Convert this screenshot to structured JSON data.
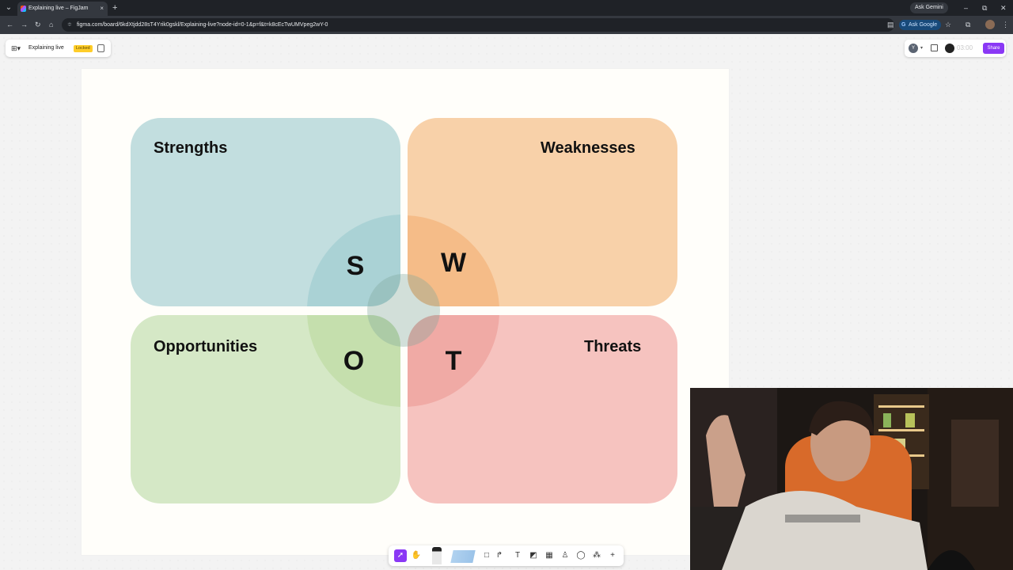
{
  "browser": {
    "tab_title": "Explaining live – FigJam",
    "tab_close": "×",
    "new_tab": "+",
    "gemini_label": "Ask Gemini",
    "url": "figma.com/board/6kdXtjdd28sT4Yrik0gskl/Explaining-live?node-id=0-1&p=f&t=k8cEcTwUMVpeg2wY-0",
    "ask_google_label": "Ask Google"
  },
  "figjam": {
    "file_title": "Explaining live",
    "file_badge": "Locked",
    "avatar_initial": "Y",
    "timer": "03:00",
    "share_label": "Share"
  },
  "swot": {
    "strengths": {
      "title": "Strengths",
      "letter": "S",
      "color": "#c2dedf"
    },
    "weaknesses": {
      "title": "Weaknesses",
      "letter": "W",
      "color": "#f8d1a9"
    },
    "opportunities": {
      "title": "Opportunities",
      "letter": "O",
      "color": "#d5e8c6"
    },
    "threats": {
      "title": "Threats",
      "letter": "T",
      "color": "#f6c3bf"
    }
  },
  "toolbar": {
    "tools": [
      "move-tool",
      "hand-tool",
      "marker-tool",
      "washi-tape-tool",
      "shape-tool",
      "connector-tool",
      "text-tool",
      "sticky-note-tool",
      "table-tool",
      "stamp-tool",
      "comment-tool",
      "more-tools",
      "add-tool"
    ]
  },
  "colors": {
    "accent": "#8a38f5",
    "badge": "#ffcd29"
  }
}
